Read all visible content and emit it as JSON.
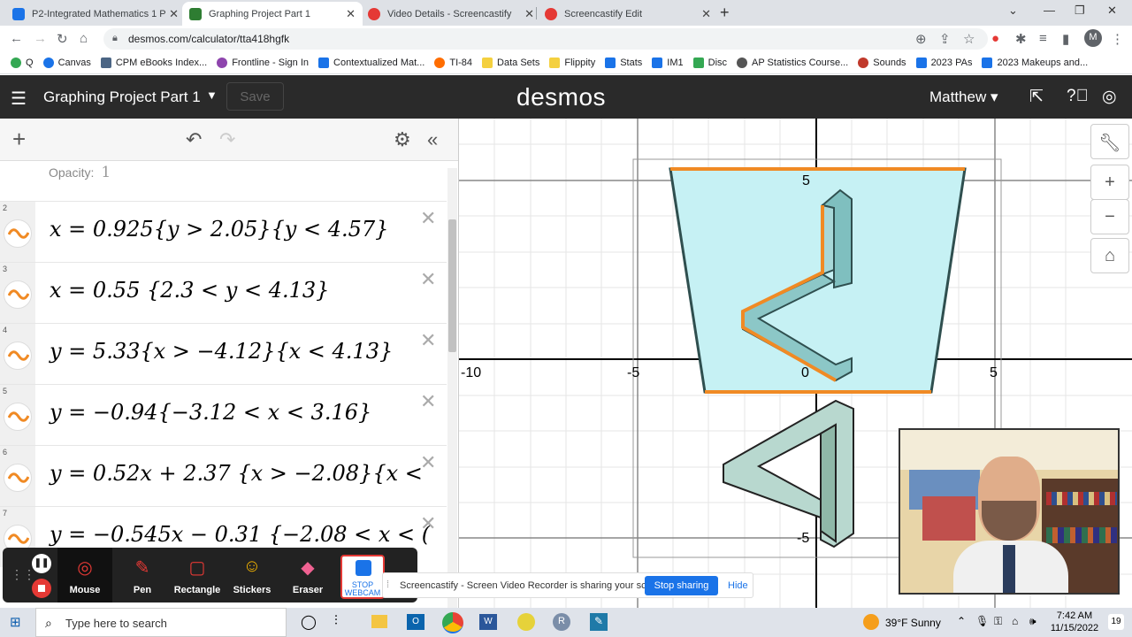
{
  "browser": {
    "tabs": [
      {
        "title": "P2-Integrated Mathematics 1 P-",
        "color": "#1a73e8"
      },
      {
        "title": "Graphing Project Part 1",
        "color": "#2e7d32"
      },
      {
        "title": "Video Details - Screencastify",
        "color": "#e53935"
      },
      {
        "title": "Screencastify Edit",
        "color": "#e53935"
      }
    ],
    "url": "desmos.com/calculator/tta418hgfk",
    "profile_initial": "M",
    "bookmarks": [
      "Q",
      "Canvas",
      "CPM eBooks Index...",
      "Frontline - Sign In",
      "Contextualized Mat...",
      "TI-84",
      "Data Sets",
      "Flippity",
      "Stats",
      "IM1",
      "Disc",
      "AP Statistics Course...",
      "Sounds",
      "2023 PAs",
      "2023 Makeups and..."
    ]
  },
  "desmos": {
    "graph_title": "Graphing Project Part 1",
    "save_label": "Save",
    "logo": "desmos",
    "user": "Matthew",
    "opacity_label": "Opacity:",
    "opacity_value": "1",
    "expressions": [
      {
        "num": "2",
        "latex": "x = 0.925{y > 2.05}{y < 4.57}"
      },
      {
        "num": "3",
        "latex": "x = 0.55 {2.3 < y < 4.13}"
      },
      {
        "num": "4",
        "latex": "y = 5.33{x > −4.12}{x < 4.13}"
      },
      {
        "num": "5",
        "latex": "y = −0.94{−3.12 < x < 3.16}"
      },
      {
        "num": "6",
        "latex": "y = 0.52x + 2.37 {x > −2.08}{x <"
      },
      {
        "num": "7",
        "latex": "y = −0.545x − 0.31 {−2.08 < x < ("
      }
    ],
    "axis_labels": {
      "x_neg10": "-10",
      "x_neg5": "-5",
      "x_0": "0",
      "x_5": "5",
      "y_5": "5",
      "y_neg5": "-5"
    },
    "accent_color": "#f08a24",
    "fill_color": "#bdeff2"
  },
  "screencastify": {
    "tools": [
      "Mouse",
      "Pen",
      "Rectangle",
      "Stickers",
      "Eraser"
    ],
    "stop_webcam": "STOP WEBCAM",
    "share_text": "Screencastify - Screen Video Recorder is sharing your screen.",
    "stop_sharing": "Stop sharing",
    "hide": "Hide"
  },
  "taskbar": {
    "search_placeholder": "Type here to search",
    "weather": "39°F  Sunny",
    "time": "7:42 AM",
    "date": "11/15/2022",
    "notifications": "19"
  }
}
